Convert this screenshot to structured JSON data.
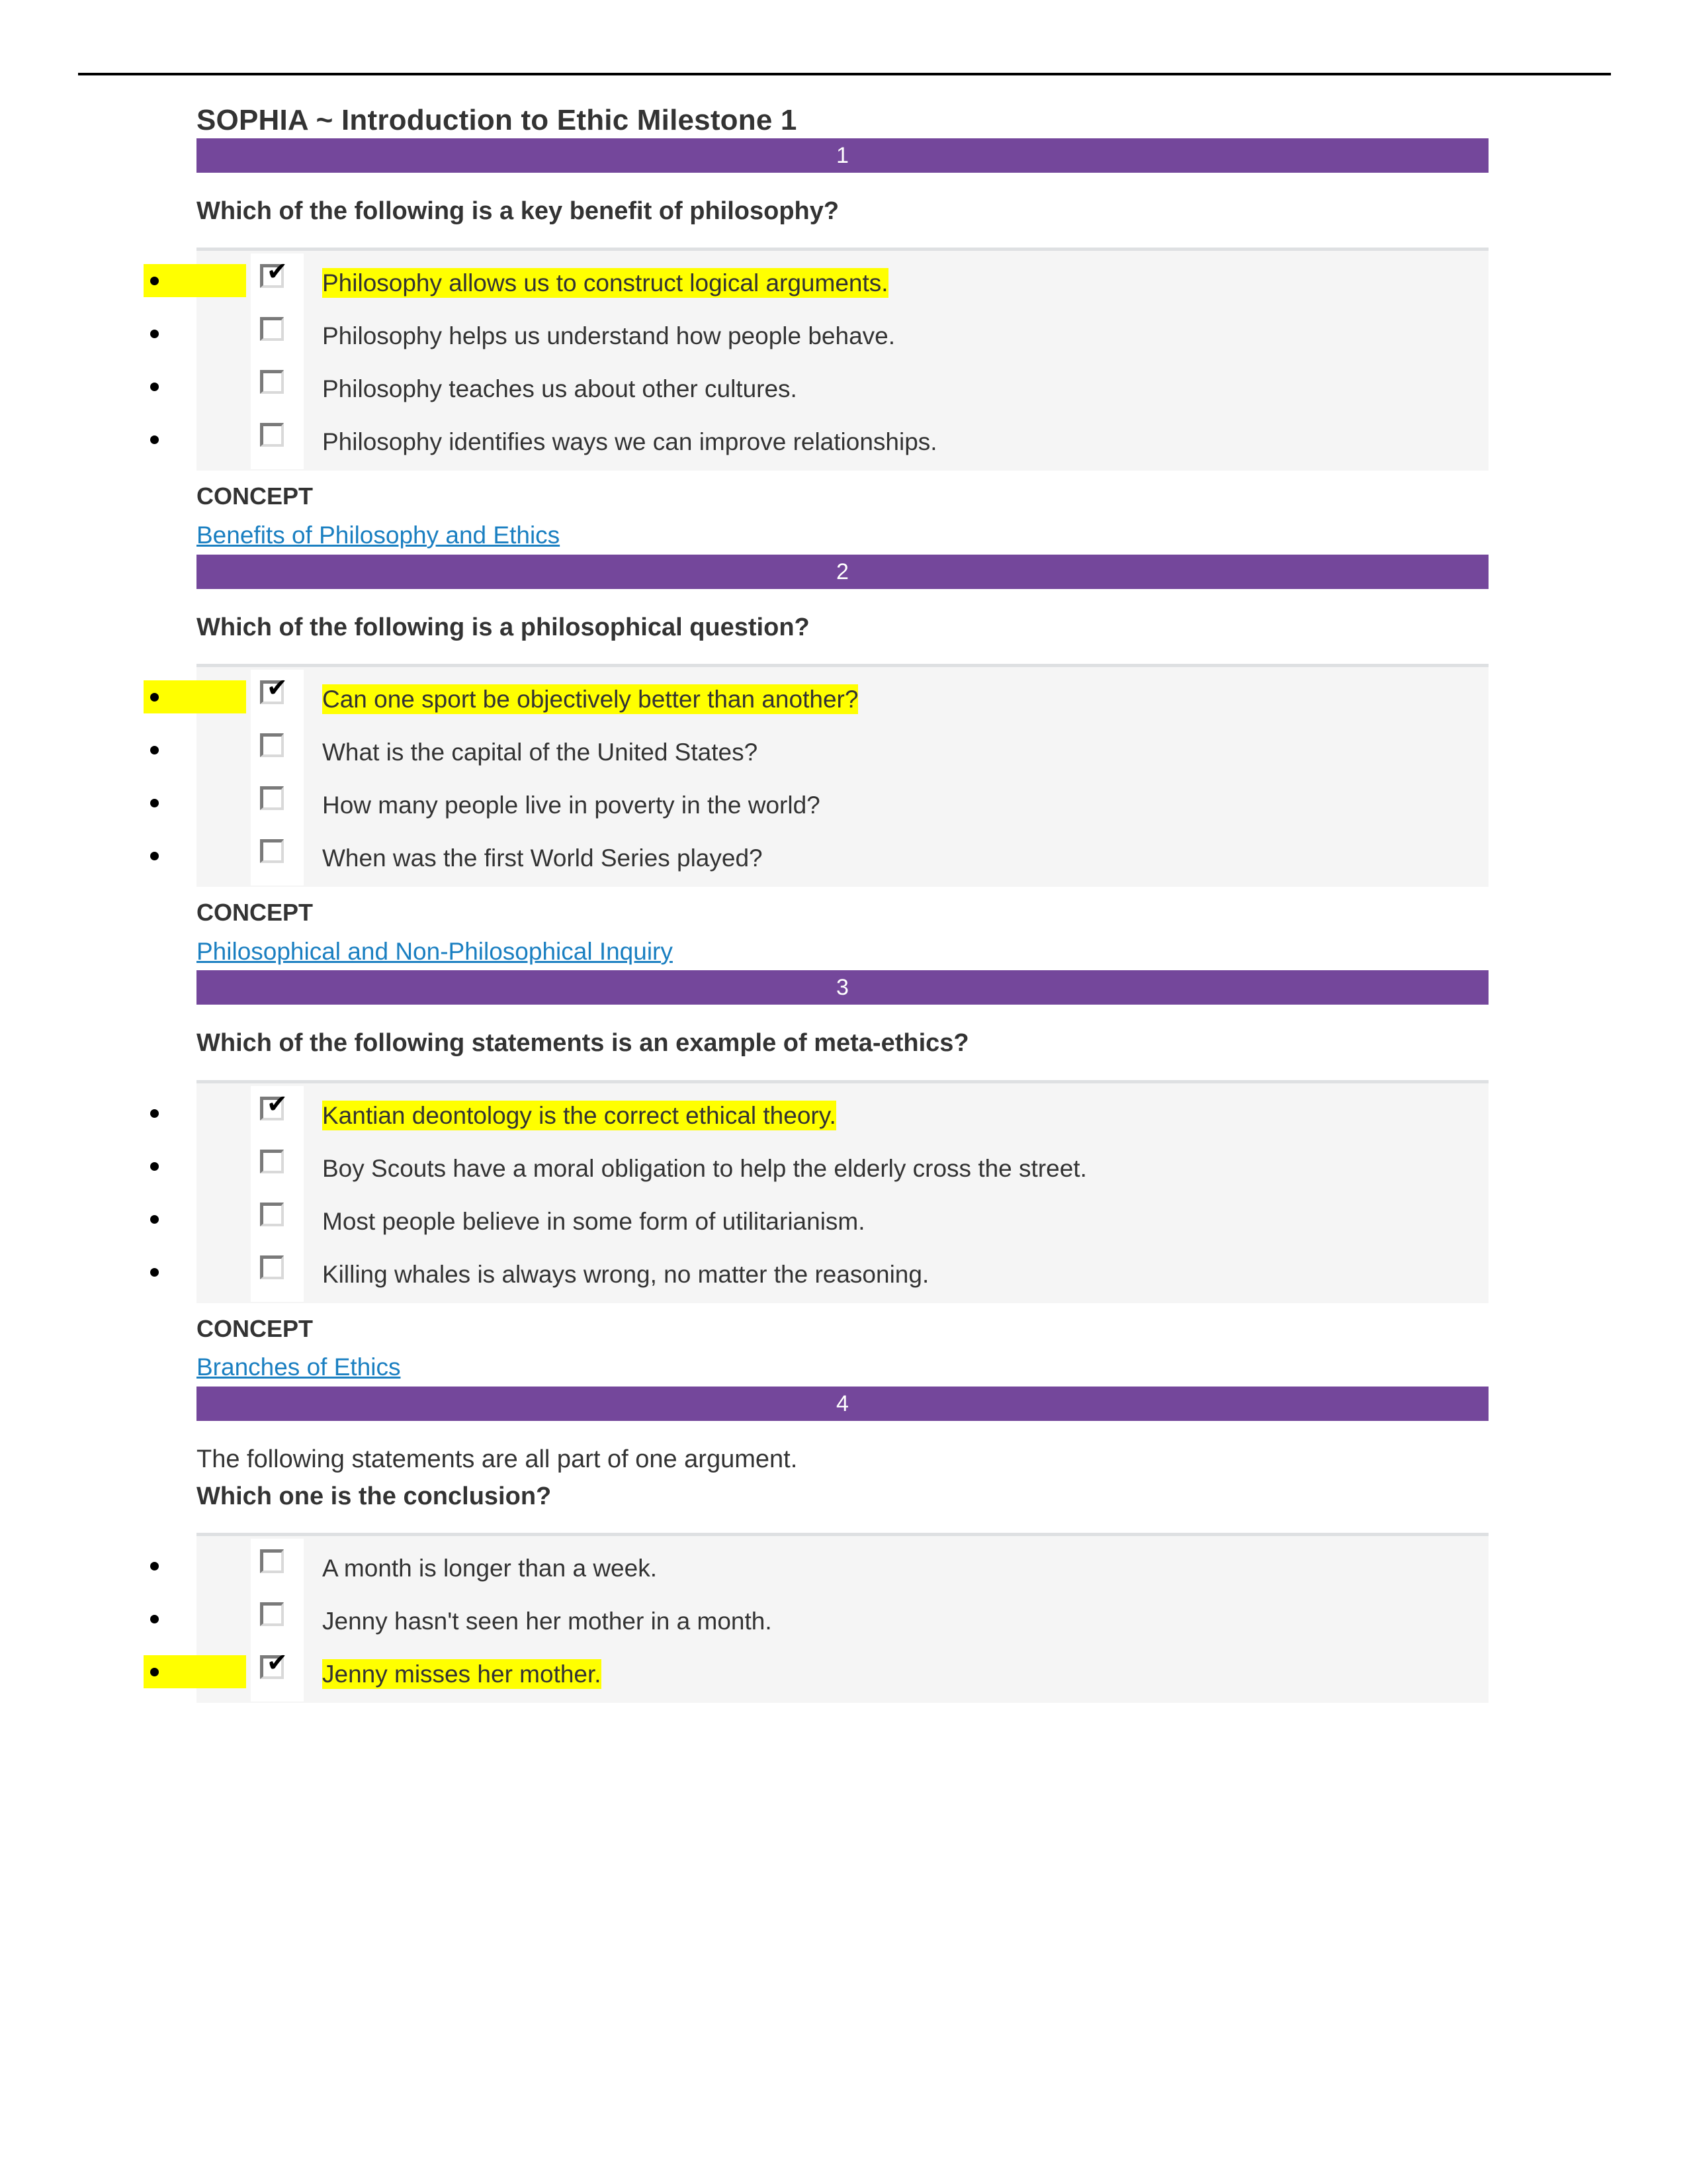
{
  "document": {
    "title": "SOPHIA ~ Introduction to Ethic Milestone 1",
    "concept_label": "CONCEPT",
    "colors": {
      "band_purple": "#74479B",
      "highlight_yellow": "#FFFF00",
      "link_blue": "#1A7FC1",
      "option_block_gray": "#F5F5F5",
      "text_gray": "#333333"
    }
  },
  "questions": [
    {
      "number": "1",
      "intro": "",
      "stem": "Which of the following is a key benefit of philosophy?",
      "options": [
        {
          "text": "Philosophy allows us to construct logical arguments.",
          "checked": true,
          "highlighted": true,
          "gutter_highlight": true
        },
        {
          "text": "Philosophy helps us understand how people behave.",
          "checked": false,
          "highlighted": false,
          "gutter_highlight": false
        },
        {
          "text": "Philosophy teaches us about other cultures.",
          "checked": false,
          "highlighted": false,
          "gutter_highlight": false
        },
        {
          "text": "Philosophy identifies ways we can improve relationships.",
          "checked": false,
          "highlighted": false,
          "gutter_highlight": false
        }
      ],
      "concept_link": "Benefits of Philosophy and Ethics"
    },
    {
      "number": "2",
      "intro": "",
      "stem": "Which of the following is a philosophical question?",
      "options": [
        {
          "text": "Can one sport be objectively better than another?",
          "checked": true,
          "highlighted": true,
          "gutter_highlight": true
        },
        {
          "text": "What is the capital of the United States?",
          "checked": false,
          "highlighted": false,
          "gutter_highlight": false
        },
        {
          "text": "How many people live in poverty in the world?",
          "checked": false,
          "highlighted": false,
          "gutter_highlight": false
        },
        {
          "text": "When was the first World Series played?",
          "checked": false,
          "highlighted": false,
          "gutter_highlight": false
        }
      ],
      "concept_link": "Philosophical and Non-Philosophical Inquiry"
    },
    {
      "number": "3",
      "intro": "",
      "stem": "Which of the following statements is an example of meta-ethics?",
      "options": [
        {
          "text": "Kantian deontology is the correct ethical theory.",
          "checked": true,
          "highlighted": true,
          "gutter_highlight": false
        },
        {
          "text": "Boy Scouts have a moral obligation to help the elderly cross the street.",
          "checked": false,
          "highlighted": false,
          "gutter_highlight": false
        },
        {
          "text": "Most people believe in some form of utilitarianism.",
          "checked": false,
          "highlighted": false,
          "gutter_highlight": false
        },
        {
          "text": "Killing whales is always wrong, no matter the reasoning.",
          "checked": false,
          "highlighted": false,
          "gutter_highlight": false
        }
      ],
      "concept_link": "Branches of Ethics"
    },
    {
      "number": "4",
      "intro": "The following statements are all part of one argument.",
      "stem": "Which one is the conclusion?",
      "options": [
        {
          "text": "A month is longer than a week.",
          "checked": false,
          "highlighted": false,
          "gutter_highlight": false
        },
        {
          "text": "Jenny hasn't seen her mother in a month.",
          "checked": false,
          "highlighted": false,
          "gutter_highlight": false
        },
        {
          "text": "Jenny misses her mother.",
          "checked": true,
          "highlighted": true,
          "gutter_highlight": true
        }
      ],
      "concept_link": ""
    }
  ]
}
